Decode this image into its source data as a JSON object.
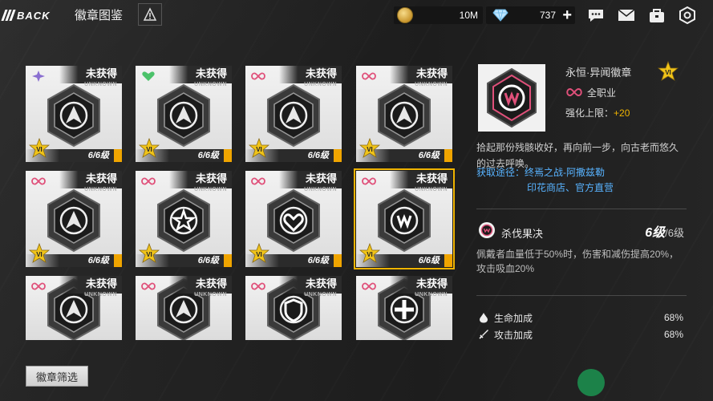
{
  "topbar": {
    "back_label": "BACK",
    "title": "徽章图鉴",
    "coins": "10M",
    "gems": "737",
    "icons": [
      "chat-icon",
      "mail-icon",
      "bag-icon",
      "settings-icon"
    ]
  },
  "status_locked": "未获得",
  "unknown_label": "UNKNOWN",
  "badges": [
    {
      "status": "未获得",
      "unknown": "UNKNOWN",
      "count": "6/6级",
      "type": "purple-star",
      "selected": false
    },
    {
      "status": "未获得",
      "unknown": "UNKNOWN",
      "count": "6/6级",
      "type": "green-heart",
      "selected": false
    },
    {
      "status": "未获得",
      "unknown": "UNKNOWN",
      "count": "6/6级",
      "type": "infinity",
      "selected": false
    },
    {
      "status": "未获得",
      "unknown": "UNKNOWN",
      "count": "6/6级",
      "type": "infinity",
      "selected": false
    },
    {
      "status": "未获得",
      "unknown": "UNKNOWN",
      "count": "6/6级",
      "type": "infinity",
      "selected": false
    },
    {
      "status": "未获得",
      "unknown": "UNKNOWN",
      "count": "6/6级",
      "type": "infinity",
      "selected": false
    },
    {
      "status": "未获得",
      "unknown": "UNKNOWN",
      "count": "6/6级",
      "type": "infinity",
      "selected": false
    },
    {
      "status": "未获得",
      "unknown": "UNKNOWN",
      "count": "6/6级",
      "type": "infinity",
      "selected": true
    },
    {
      "status": "未获得",
      "unknown": "UNKNOWN",
      "count": "",
      "type": "infinity",
      "selected": false
    },
    {
      "status": "未获得",
      "unknown": "UNKNOWN",
      "count": "",
      "type": "infinity",
      "selected": false
    },
    {
      "status": "未获得",
      "unknown": "UNKNOWN",
      "count": "",
      "type": "infinity",
      "selected": false
    },
    {
      "status": "未获得",
      "unknown": "UNKNOWN",
      "count": "",
      "type": "infinity",
      "selected": false
    }
  ],
  "filter_label": "徽章筛选",
  "detail": {
    "name": "永恒·异闻徽章",
    "class_label": "全职业",
    "enhance_label": "强化上限：",
    "enhance_value": "+20",
    "description": "拾起那份残骸收好，再向前一步，向古老而悠久的过去呼唤。",
    "acquire_label": "获取途径：",
    "acquire_line1": "终焉之战-阿撒兹勒",
    "acquire_line2": "印花商店、官方直营",
    "skill_name": "杀伐果决",
    "skill_level": "6级",
    "skill_max": "/6级",
    "skill_desc": "佩戴者血量低于50%时，伤害和减伤提高20%，攻击吸血20%",
    "stats": [
      {
        "label": "生命加成",
        "value": "68%"
      },
      {
        "label": "攻击加成",
        "value": "68%"
      }
    ]
  },
  "colors": {
    "accent": "#f0b400",
    "link": "#58b3ff",
    "infinity": "#e0507a"
  }
}
